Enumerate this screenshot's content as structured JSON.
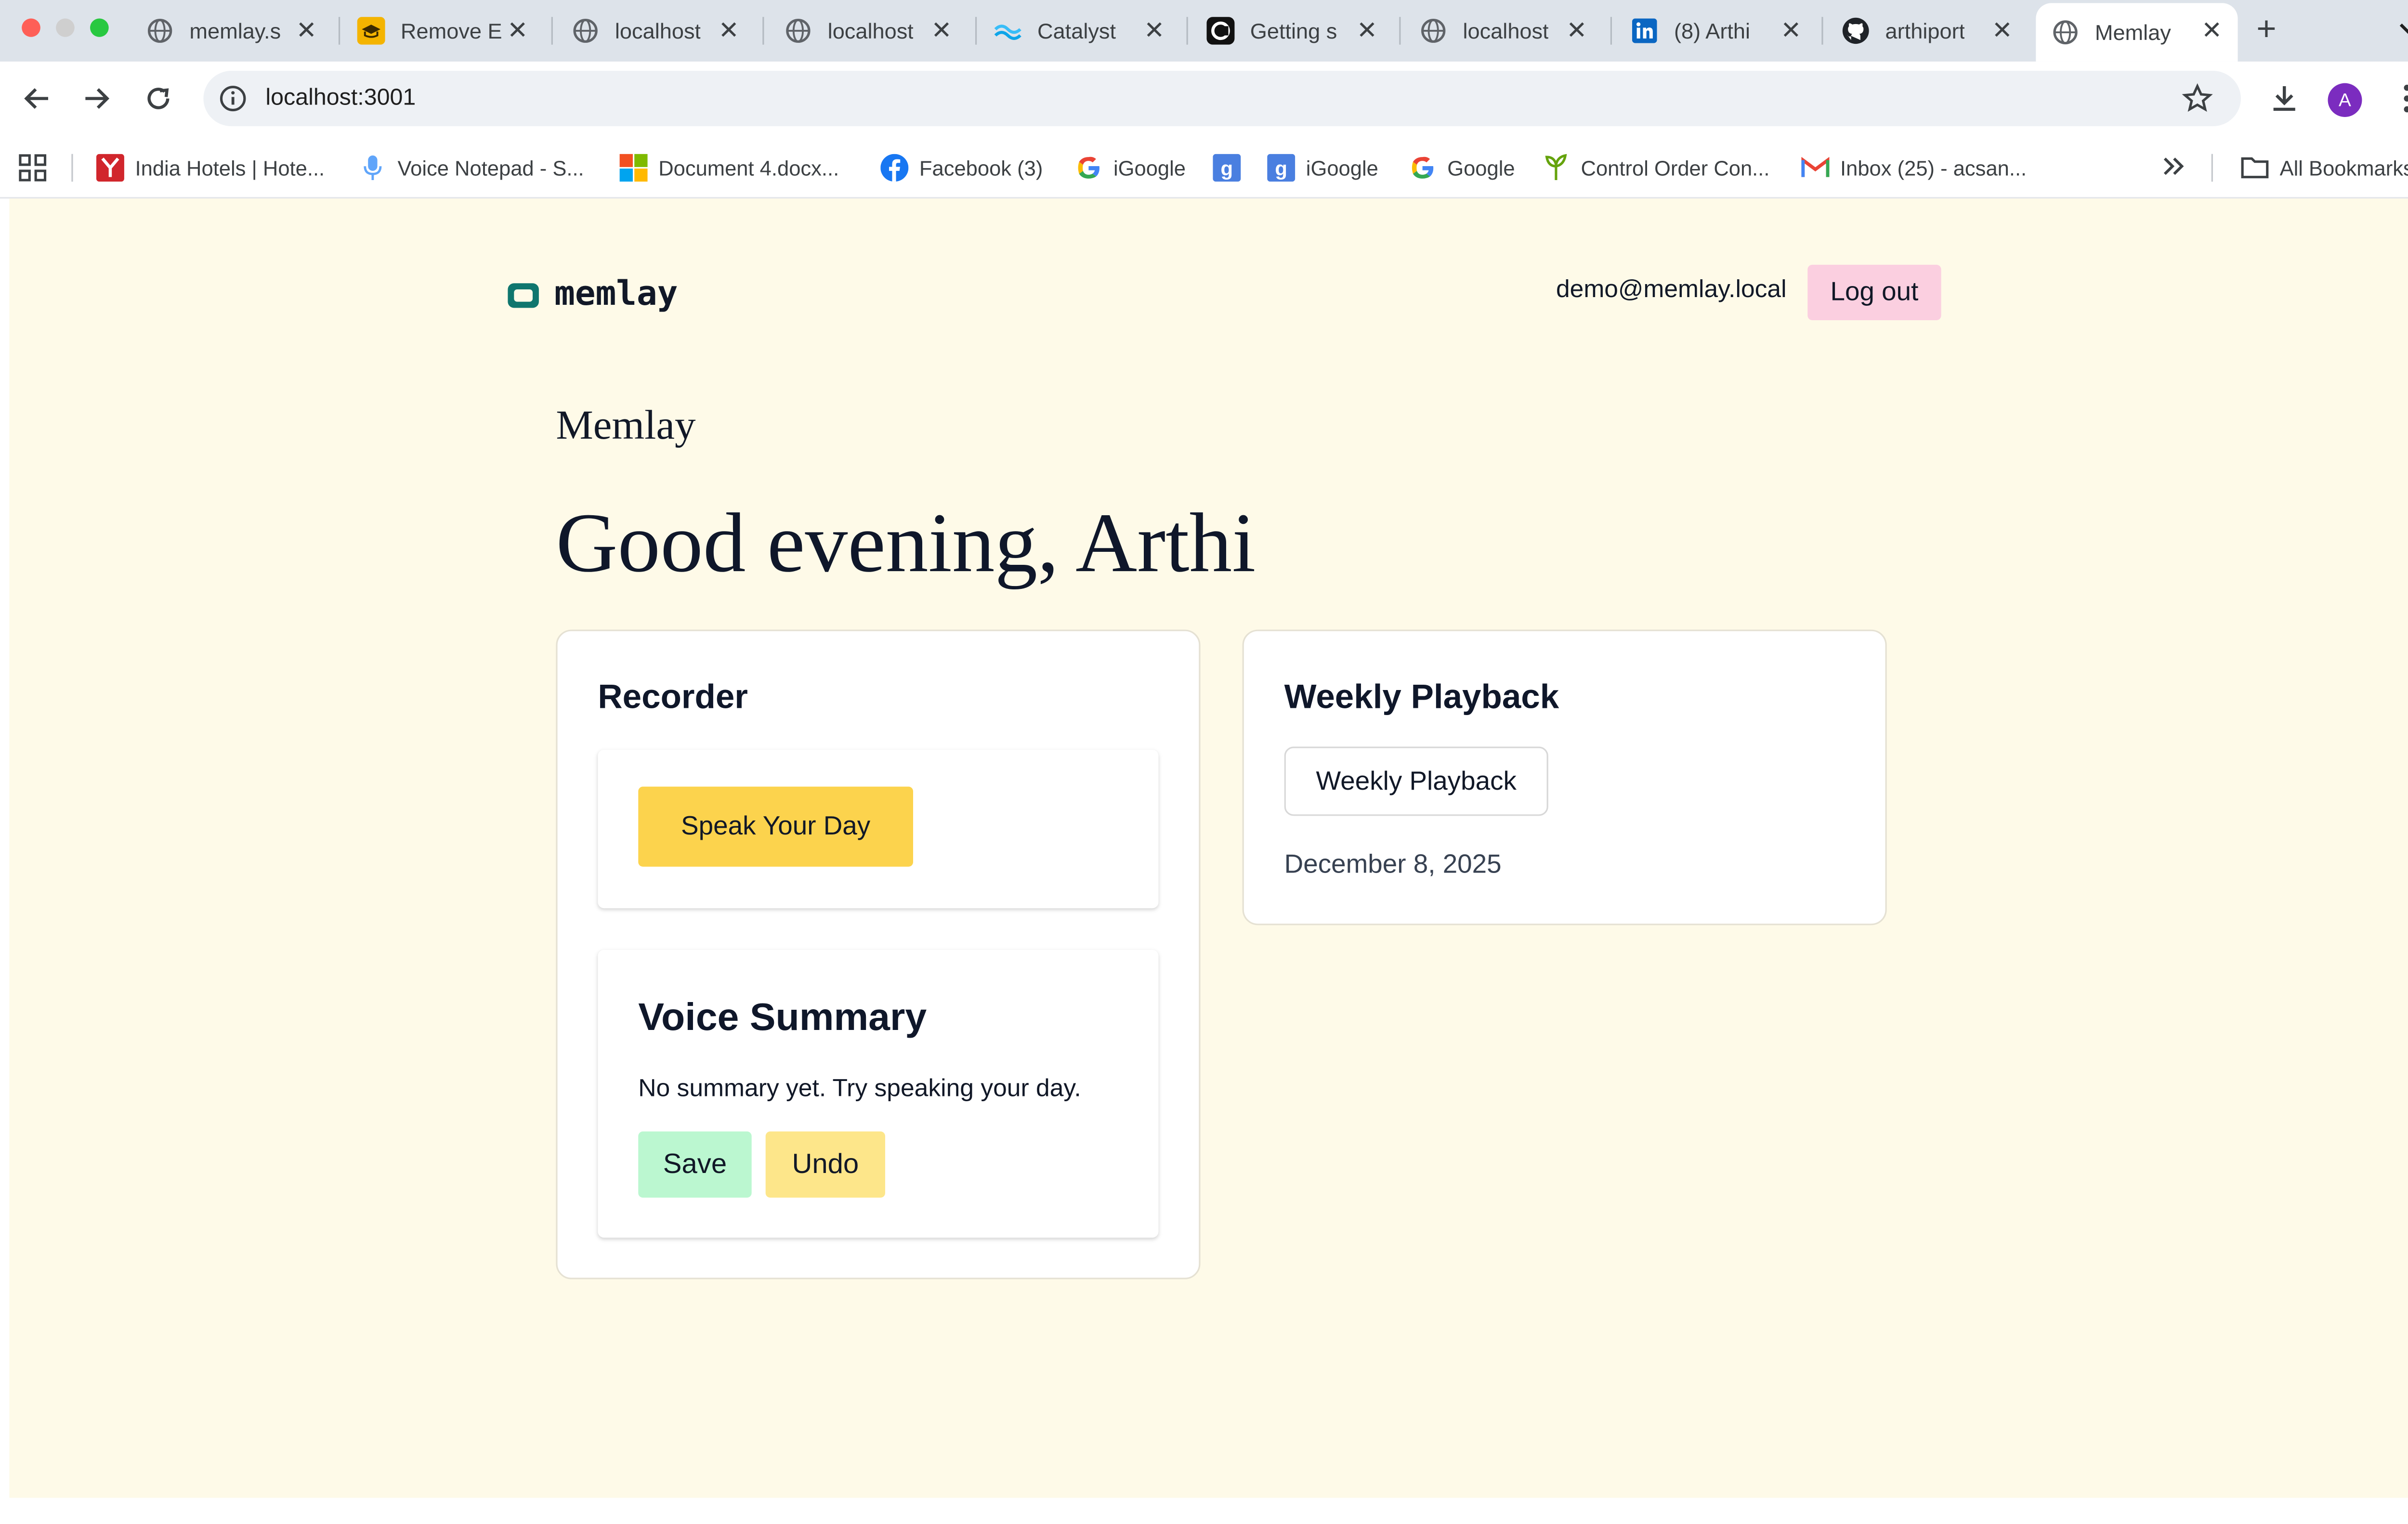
{
  "browser": {
    "tabs": [
      {
        "title": "memlay.s",
        "icon": "globe-icon"
      },
      {
        "title": "Remove E",
        "icon": "graduation-cap-icon"
      },
      {
        "title": "localhost",
        "icon": "globe-icon"
      },
      {
        "title": "localhost",
        "icon": "globe-icon"
      },
      {
        "title": "Catalyst",
        "icon": "wave-icon"
      },
      {
        "title": "Getting s",
        "icon": "cursor-logo-icon"
      },
      {
        "title": "localhost",
        "icon": "globe-icon"
      },
      {
        "title": "(8) Arthi",
        "icon": "linkedin-icon"
      },
      {
        "title": "arthiport",
        "icon": "github-icon"
      },
      {
        "title": "Memlay",
        "icon": "globe-icon",
        "active": true
      }
    ],
    "url": "localhost:3001",
    "profile_initial": "A",
    "bookmarks": [
      {
        "label": "India Hotels | Hote...",
        "icon": "y-logo-icon"
      },
      {
        "label": "Voice Notepad - S...",
        "icon": "microphone-icon"
      },
      {
        "label": "Document 4.docx...",
        "icon": "microsoft-logo-icon"
      },
      {
        "label": "Facebook (3)",
        "icon": "facebook-icon"
      },
      {
        "label": "iGoogle",
        "icon": "google-icon"
      },
      {
        "label": "",
        "icon": "google-plus-icon"
      },
      {
        "label": "iGoogle",
        "icon": "google-plus-icon"
      },
      {
        "label": "Google",
        "icon": "google-icon"
      },
      {
        "label": "Control Order Con...",
        "icon": "leaf-icon"
      },
      {
        "label": "Inbox (25) - acsan...",
        "icon": "gmail-icon"
      }
    ],
    "all_bookmarks_label": "All Bookmarks",
    "colors": {
      "tabstrip": "#dde3ea",
      "omnibox": "#eef1f5"
    }
  },
  "app": {
    "logo_text": "memlay",
    "user_email": "demo@memlay.local",
    "logout_label": "Log out",
    "brand_subtitle": "Memlay",
    "greeting": "Good evening, Arthi",
    "recorder": {
      "title": "Recorder",
      "speak_button": "Speak Your Day"
    },
    "voice_summary": {
      "title": "Voice Summary",
      "empty_text": "No summary yet. Try speaking your day.",
      "save_label": "Save",
      "undo_label": "Undo"
    },
    "weekly": {
      "title": "Weekly Playback",
      "button_label": "Weekly Playback",
      "date": "December 8, 2025"
    },
    "colors": {
      "background": "#fefae8",
      "accent_teal": "#0f766e",
      "speak_button": "#fcd34d",
      "save_button": "#bbf7d0",
      "undo_button": "#fde68a",
      "logout_button": "#fbcfe0"
    }
  }
}
